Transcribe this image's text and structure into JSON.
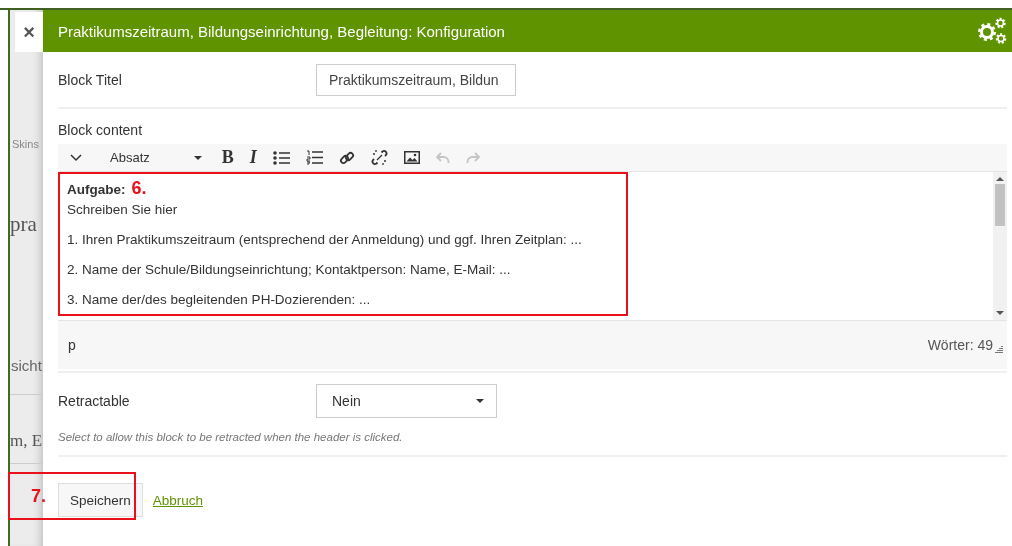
{
  "background_page": {
    "close_label": "×",
    "fragments": [
      "Skins",
      "pra",
      "sicht",
      "m, E"
    ]
  },
  "window": {
    "title": "Praktikumszeitraum, Bildungseinrichtung, Begleitung: Konfiguration"
  },
  "block_title": {
    "label": "Block Titel",
    "value": "Praktikumszeitraum, Bildun"
  },
  "block_content": {
    "label": "Block content",
    "toolbar": [
      {
        "kind": "collapse",
        "disabled": false
      },
      {
        "kind": "format",
        "label": "Absatz",
        "disabled": false
      },
      {
        "kind": "bold",
        "label": "B",
        "disabled": false
      },
      {
        "kind": "italic",
        "label": "I",
        "disabled": false
      },
      {
        "kind": "bullets",
        "disabled": false
      },
      {
        "kind": "numbering",
        "disabled": false
      },
      {
        "kind": "link",
        "disabled": false
      },
      {
        "kind": "unlink",
        "disabled": false
      },
      {
        "kind": "image",
        "disabled": false
      },
      {
        "kind": "undo",
        "disabled": true
      },
      {
        "kind": "redo",
        "disabled": true
      }
    ],
    "lines": [
      {
        "kind": "heading",
        "text": "Aufgabe:"
      },
      {
        "kind": "line",
        "text": "Schreiben Sie hier"
      },
      {
        "kind": "paragraph",
        "text": "1. Ihren Praktikumszeitraum (entsprechend der Anmeldung) und ggf. Ihren Zeitplan: ..."
      },
      {
        "kind": "paragraph",
        "text": "2. Name der Schule/Bildungseinrichtung; Kontaktperson: Name, E-Mail: ..."
      },
      {
        "kind": "paragraph",
        "text": "3. Name der/des begleitenden PH-Dozierenden: ..."
      }
    ],
    "annotation": "6.",
    "path": "p",
    "word_count": "Wörter: 49"
  },
  "retractable": {
    "label": "Retractable",
    "value": "Nein",
    "help": "Select to allow this block to be retracted when the header is clicked."
  },
  "buttons": {
    "annotation": "7.",
    "save": "Speichern",
    "cancel": "Abbruch"
  }
}
